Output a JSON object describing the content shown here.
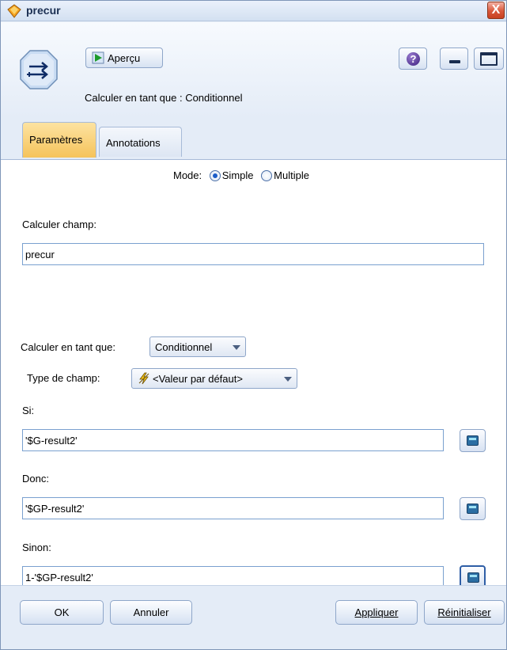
{
  "window": {
    "title": "precur",
    "close_label": "X"
  },
  "header": {
    "preview_label": "Aperçu",
    "help_label": "?",
    "calc_as_label": "Calculer en tant que : Conditionnel"
  },
  "tabs": [
    {
      "label": "Paramètres",
      "active": true
    },
    {
      "label": "Annotations",
      "active": false
    }
  ],
  "settings": {
    "mode_label": "Mode:",
    "mode_options": [
      "Simple",
      "Multiple"
    ],
    "mode_selected": "Simple",
    "derive_field_label": "Calculer champ:",
    "derive_field_value": "precur",
    "derive_as_label": "Calculer en tant que:",
    "derive_as_value": "Conditionnel",
    "field_type_label": "Type de champ:",
    "field_type_value": "<Valeur par défaut>",
    "if_label": "Si:",
    "if_value": "'$G-result2'",
    "then_label": "Donc:",
    "then_value": "'$GP-result2'",
    "else_label": "Sinon:",
    "else_value": "1-'$GP-result2'"
  },
  "footer": {
    "ok_label": "OK",
    "cancel_label": "Annuler",
    "apply_label": "Appliquer",
    "reset_label": "Réinitialiser"
  },
  "colors": {
    "accent_tab": "#f5c35b",
    "window_bg": "#e8eef7"
  }
}
